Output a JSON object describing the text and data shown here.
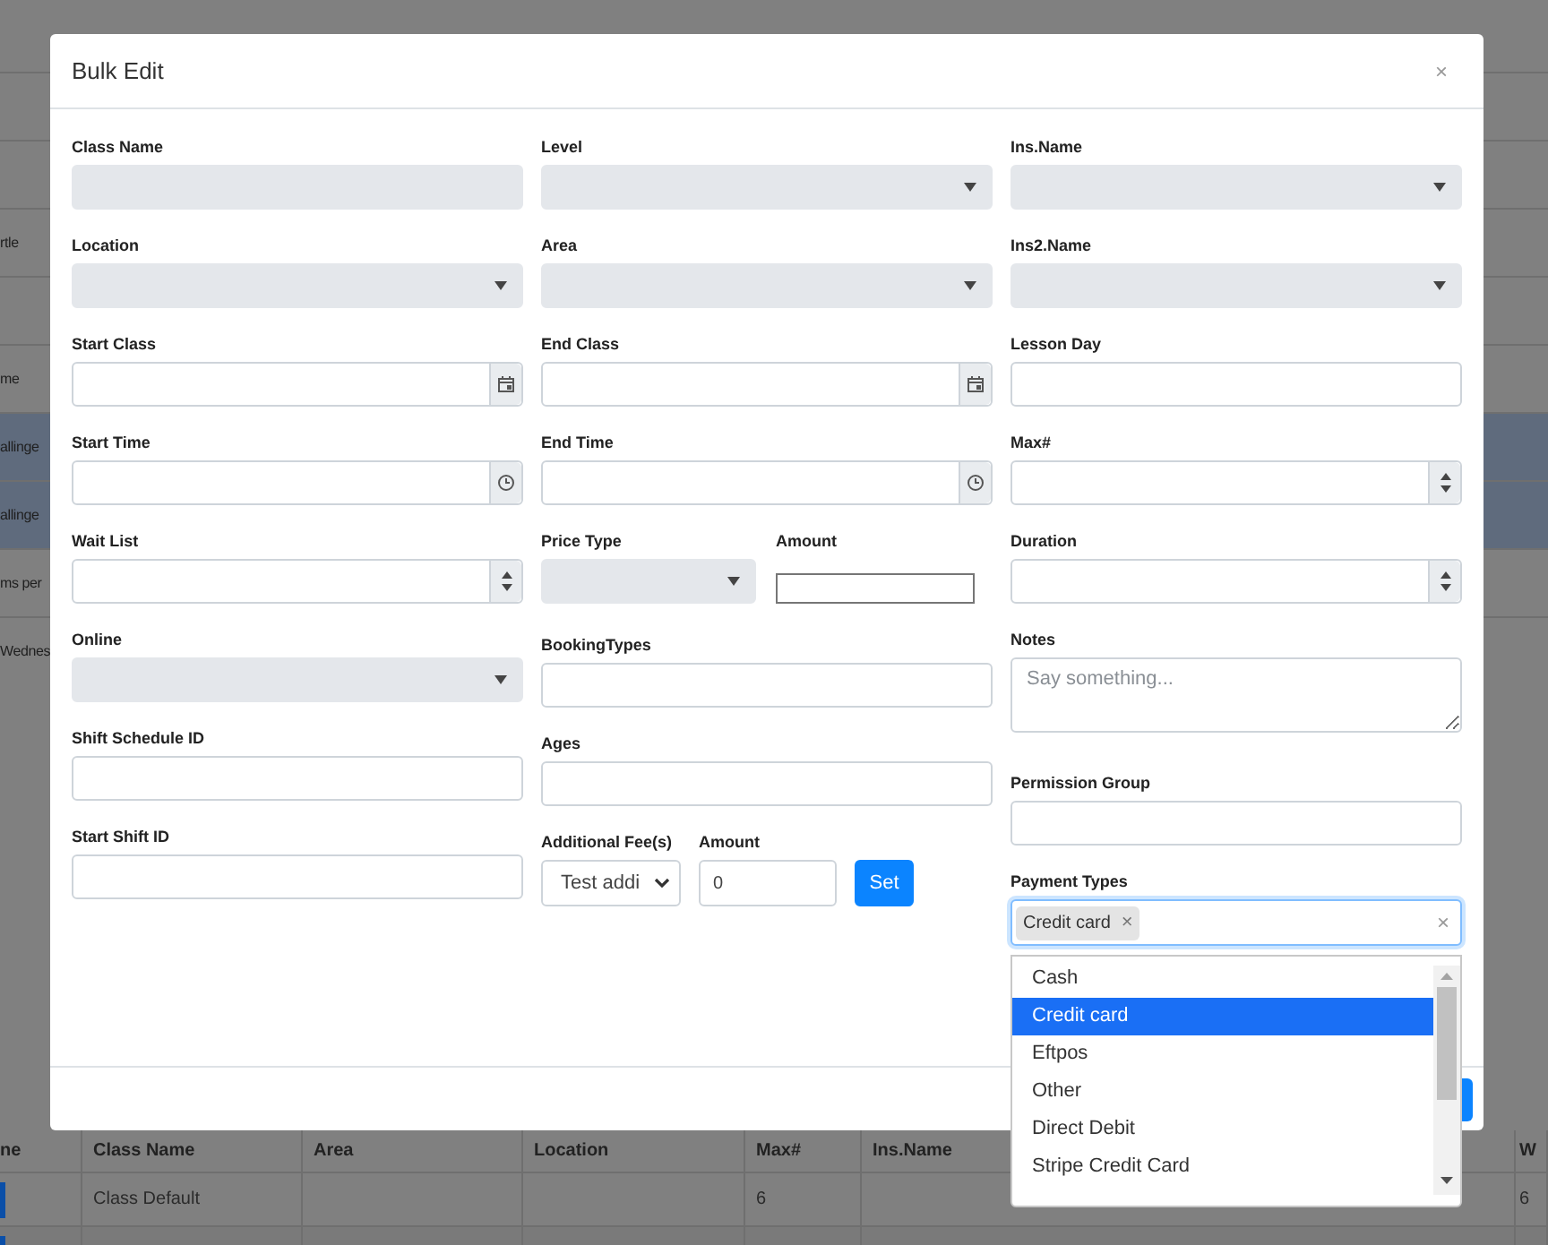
{
  "background": {
    "side_rows": [
      {
        "text": null,
        "selected": false
      },
      {
        "text": null,
        "selected": false
      },
      {
        "text": "rtle",
        "selected": false
      },
      {
        "text": null,
        "selected": false
      },
      {
        "text": "me",
        "selected": false
      },
      {
        "text": "allinge",
        "selected": true
      },
      {
        "text": "allinge",
        "selected": true
      },
      {
        "text": "ms per",
        "selected": false
      },
      {
        "text": "Wednes",
        "selected": false
      }
    ],
    "table": {
      "columns": [
        "ne",
        "Class Name",
        "Area",
        "Location",
        "Max#",
        "Ins.Name",
        "W"
      ],
      "rows": [
        [
          null,
          "Class Default",
          null,
          null,
          "6",
          null,
          "6"
        ],
        [
          null,
          null,
          null,
          null,
          null,
          null,
          null
        ]
      ]
    }
  },
  "modal": {
    "title": "Bulk Edit",
    "close": "×",
    "columns": [
      [
        {
          "label": "Class Name",
          "kind": "text",
          "disabled": true
        },
        {
          "label": "Location",
          "kind": "select",
          "disabled": true
        },
        {
          "label": "Start Class",
          "kind": "date",
          "disabled": false
        },
        {
          "label": "Start Time",
          "kind": "time",
          "disabled": false
        },
        {
          "label": "Wait List",
          "kind": "number",
          "disabled": false
        },
        {
          "label": "Online",
          "kind": "select",
          "disabled": true
        },
        {
          "label": "Shift Schedule ID",
          "kind": "text",
          "disabled": false
        },
        {
          "label": "Start Shift ID",
          "kind": "text",
          "disabled": false
        }
      ],
      [
        {
          "label": "Level",
          "kind": "select",
          "disabled": true
        },
        {
          "label": "Area",
          "kind": "select",
          "disabled": true
        },
        {
          "label": "End Class",
          "kind": "date",
          "disabled": false
        },
        {
          "label": "End Time",
          "kind": "time",
          "disabled": false
        },
        {
          "kind": "pair",
          "items": [
            {
              "label": "Price Type",
              "kind": "select",
              "disabled": true
            },
            {
              "label": "Amount",
              "kind": "plain"
            }
          ]
        },
        {
          "label": "BookingTypes",
          "kind": "text",
          "disabled": false
        },
        {
          "label": "Ages",
          "kind": "text",
          "disabled": false
        },
        {
          "kind": "fee",
          "items": [
            {
              "label": "Additional Fee(s)",
              "kind": "native_select",
              "value": "Test addi"
            },
            {
              "label": "Amount",
              "kind": "value",
              "value": "0"
            },
            {
              "kind": "button",
              "label": "Set"
            }
          ]
        }
      ],
      [
        {
          "label": "Ins.Name",
          "kind": "select",
          "disabled": true
        },
        {
          "label": "Ins2.Name",
          "kind": "select",
          "disabled": true
        },
        {
          "label": "Lesson Day",
          "kind": "text",
          "disabled": false
        },
        {
          "label": "Max#",
          "kind": "number",
          "disabled": false
        },
        {
          "label": "Duration",
          "kind": "number",
          "disabled": false
        },
        {
          "label": "Notes",
          "kind": "textarea",
          "placeholder": "Say something..."
        },
        {
          "label": "Permission Group",
          "kind": "text",
          "disabled": false
        },
        {
          "label": "Payment Types",
          "kind": "multiselect",
          "tags": [
            {
              "label": "Credit card",
              "remove": "×"
            }
          ],
          "clear": "×",
          "options": [
            {
              "label": "Cash",
              "selected": false
            },
            {
              "label": "Credit card",
              "selected": true
            },
            {
              "label": "Eftpos",
              "selected": false
            },
            {
              "label": "Other",
              "selected": false
            },
            {
              "label": "Direct Debit",
              "selected": false
            },
            {
              "label": "Stripe Credit Card",
              "selected": false
            }
          ]
        }
      ]
    ]
  }
}
